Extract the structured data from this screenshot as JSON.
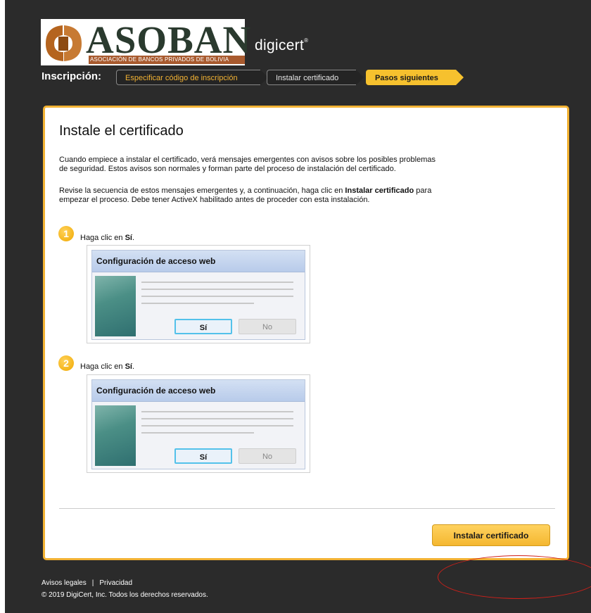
{
  "logo": {
    "wordmark": "ASOBAN",
    "subtitle": "ASOCIACIÓN DE BANCOS PRIVADOS DE BOLIVIA",
    "partner": "digicert",
    "partner_mark": "®"
  },
  "steps": {
    "label": "Inscripción:",
    "items": [
      {
        "label": "Especificar código de inscripción",
        "state": "done"
      },
      {
        "label": "Instalar certificado",
        "state": "done"
      },
      {
        "label": "Pasos siguientes",
        "state": "active"
      }
    ]
  },
  "panel": {
    "title": "Instale el certificado",
    "para1_line1": "Cuando empiece a instalar el certificado, verá mensajes emergentes con avisos sobre los posibles problemas",
    "para1_line2": "de seguridad. Estos avisos son normales y forman parte del proceso de instalación del certificado.",
    "para2_line1_pre": "Revise la secuencia de estos mensajes emergentes y, a continuación, haga clic en ",
    "para2_line1_bold": "Instalar certificado",
    "para2_line1_post": " para",
    "para2_line2": "empezar el proceso. Debe tener ActiveX habilitado antes de proceder con esta instalación.",
    "instructions": [
      {
        "number": "1",
        "text_pre": "Haga clic en ",
        "text_bold": "Sí",
        "text_post": "."
      },
      {
        "number": "2",
        "text_pre": "Haga clic en ",
        "text_bold": "Sí",
        "text_post": "."
      }
    ],
    "dialog": {
      "title": "Configuración de acceso web",
      "yes": "Sí",
      "no": "No"
    },
    "install_button": "Instalar certificado"
  },
  "footer": {
    "legal": "Avisos legales",
    "divider": "|",
    "privacy": "Privacidad",
    "copyright": "© 2019 DigiCert, Inc. Todos los derechos reservados."
  },
  "colors": {
    "accent": "#f2b233",
    "background": "#2b2b2b",
    "annotation": "#d0201a"
  }
}
